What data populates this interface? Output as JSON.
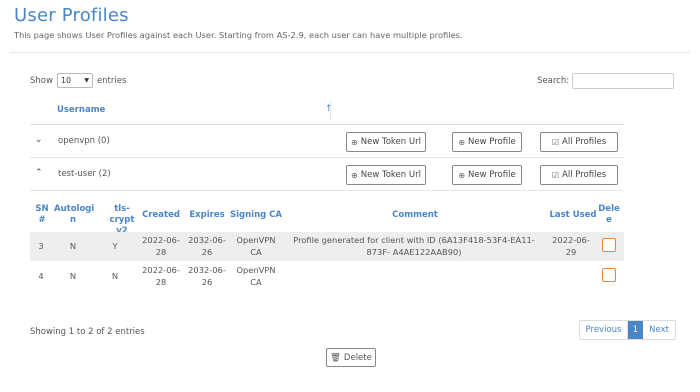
{
  "page": {
    "title": "User Profiles",
    "description": "This page shows User Profiles against each User. Starting from AS-2.9, each user can have multiple profiles."
  },
  "controls": {
    "show_label": "Show",
    "length_value": "10",
    "entries_label": "entries",
    "search_label": "Search:",
    "search_value": ""
  },
  "table": {
    "username_header": "Username",
    "sort_icon": "sort-ascending-icon"
  },
  "groups": [
    {
      "name": "openvpn (0)",
      "toggle": "chevron-down-icon",
      "expanded": false
    },
    {
      "name": "test-user (2)",
      "toggle": "chevron-up-icon",
      "expanded": true
    }
  ],
  "buttons": {
    "new_token": "New Token Url",
    "new_profile": "New Profile",
    "all_profiles": "All Profiles"
  },
  "profiles_table": {
    "headers": {
      "sn": "SN #",
      "autologin": "Autologi n",
      "tls": "tls-crypt v2",
      "created": "Created",
      "expires": "Expires",
      "signing_ca": "Signing CA",
      "comment": "Comment",
      "last_used": "Last Used",
      "delete": "Dele e"
    },
    "rows": [
      {
        "sn": "3",
        "autologin": "N",
        "tls": "Y",
        "created": "2022-06- 28",
        "expires": "2032-06- 26",
        "signing_ca": "OpenVPN CA",
        "comment": "Profile generated for client with ID (6A13F418-53F4-EA11-873F- A4AE122AAB90)",
        "last_used": "2022-06- 29",
        "checked": false
      },
      {
        "sn": "4",
        "autologin": "N",
        "tls": "N",
        "created": "2022-06- 28",
        "expires": "2032-06- 26",
        "signing_ca": "OpenVPN CA",
        "comment": "",
        "last_used": "",
        "checked": false
      }
    ]
  },
  "footer": {
    "info": "Showing 1 to 2 of 2 entries",
    "prev": "Previous",
    "page": "1",
    "next": "Next",
    "delete": "Delete"
  },
  "colors": {
    "accent": "#4a86c5",
    "checkbox_border": "#e08a3c"
  }
}
